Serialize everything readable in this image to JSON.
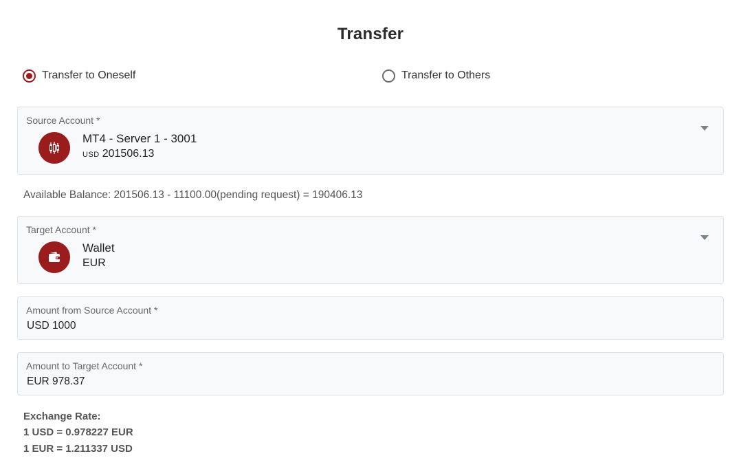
{
  "page": {
    "title": "Transfer"
  },
  "transfer_type": {
    "options": [
      {
        "label": "Transfer to Oneself",
        "selected": true
      },
      {
        "label": "Transfer to Others",
        "selected": false
      }
    ]
  },
  "source_account": {
    "label": "Source Account *",
    "name": "MT4 - Server 1 - 3001",
    "currency": "USD",
    "balance": "201506.13",
    "icon": "candlestick-chart-icon"
  },
  "available_balance": "Available Balance: 201506.13 - 11100.00(pending request) = 190406.13",
  "target_account": {
    "label": "Target Account *",
    "name": "Wallet",
    "currency": "EUR",
    "icon": "wallet-icon"
  },
  "amount_from": {
    "label": "Amount from Source Account *",
    "value": "USD 1000"
  },
  "amount_to": {
    "label": "Amount to Target Account *",
    "value": "EUR 978.37"
  },
  "exchange_rate": {
    "heading": "Exchange Rate:",
    "line1": "1 USD = 0.978227 EUR",
    "line2": "1 EUR = 1.211337 USD"
  },
  "colors": {
    "accent": "#9b1c1c",
    "field_bg": "#f7f9fb",
    "field_border": "#dfe3e8"
  }
}
